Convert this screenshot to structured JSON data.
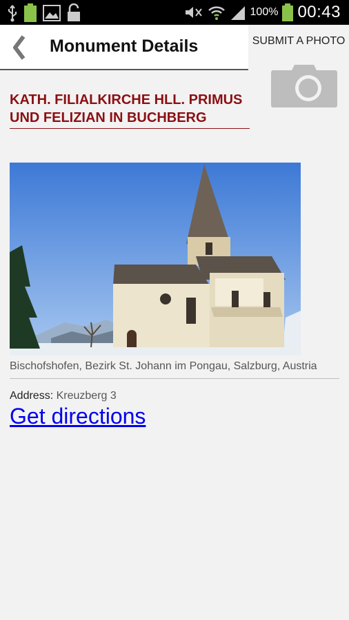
{
  "status_bar": {
    "battery_percent": "100%",
    "time": "00:43"
  },
  "header": {
    "title": "Monument Details",
    "back_icon": "chevron-left-icon"
  },
  "submit_photo": {
    "label": "SUBMIT A PHOTO",
    "icon": "camera-icon"
  },
  "monument": {
    "name": "KATH. FILIALKIRCHE HLL. PRIMUS UND FELIZIAN IN BUCHBERG",
    "location": "Bischofshofen, Bezirk St. Johann im Pongau, Salzburg, Austria",
    "address_label": "Address:",
    "address_value": "Kreuzberg 3",
    "directions_link": "Get directions"
  },
  "colors": {
    "accent": "#8b0f12",
    "link": "#0000ee",
    "battery": "#8bc34a"
  }
}
